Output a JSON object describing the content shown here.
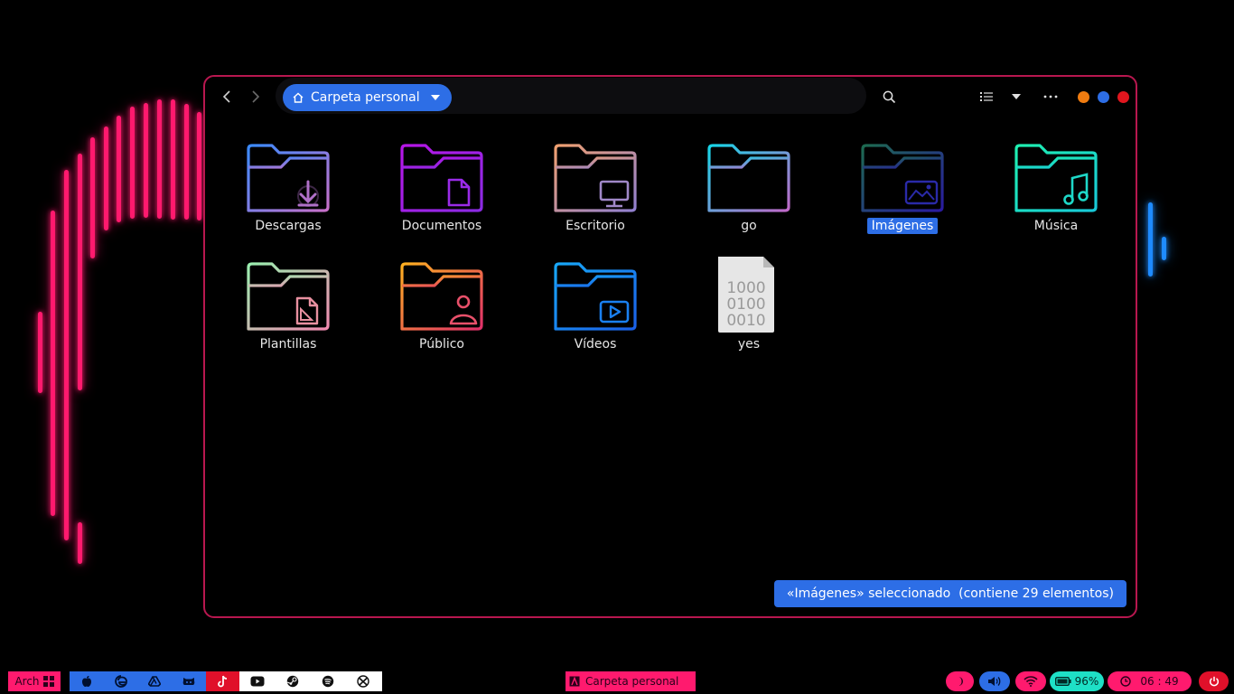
{
  "window": {
    "path_label": "Carpeta personal",
    "status_text": "«Imágenes» seleccionado  (contiene 29 elementos)",
    "controls": [
      "minimize-dot",
      "maximize-dot",
      "close-dot"
    ],
    "accent": "#2d6ee6",
    "border": "#b8174f"
  },
  "files": [
    {
      "label": "Descargas",
      "kind": "folder",
      "emblem": "download-icon"
    },
    {
      "label": "Documentos",
      "kind": "folder",
      "emblem": "document-icon"
    },
    {
      "label": "Escritorio",
      "kind": "folder",
      "emblem": "monitor-icon"
    },
    {
      "label": "go",
      "kind": "folder",
      "emblem": ""
    },
    {
      "label": "Imágenes",
      "kind": "folder",
      "emblem": "image-icon",
      "selected": true
    },
    {
      "label": "Música",
      "kind": "folder",
      "emblem": "music-icon"
    },
    {
      "label": "Plantillas",
      "kind": "folder",
      "emblem": "template-icon"
    },
    {
      "label": "Público",
      "kind": "folder",
      "emblem": "person-icon"
    },
    {
      "label": "Vídeos",
      "kind": "folder",
      "emblem": "video-icon"
    },
    {
      "label": "yes",
      "kind": "binary-file",
      "lines": [
        "1000",
        "0100",
        "0010"
      ]
    }
  ],
  "taskbar": {
    "launcher_label": "Arch",
    "active_window": "Carpeta personal",
    "battery": "96%",
    "clock": "06 : 49",
    "apps": [
      "apple-icon",
      "edge-icon",
      "drive-icon",
      "github-icon",
      "tiktok-icon",
      "youtube-icon",
      "steam-icon",
      "spotify-icon",
      "xbox-icon"
    ]
  }
}
